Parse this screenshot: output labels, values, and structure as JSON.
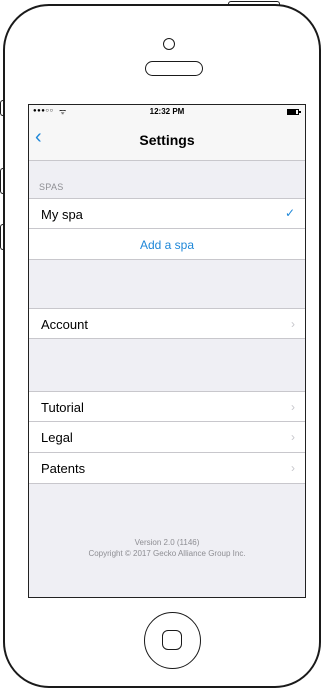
{
  "status_bar": {
    "signal": "●●●○○",
    "wifi": "ᯤ",
    "time": "12:32 PM"
  },
  "nav": {
    "back_icon": "‹",
    "title": "Settings"
  },
  "spas": {
    "header": "SPAS",
    "items": [
      {
        "label": "My spa",
        "selected": true
      }
    ],
    "check_icon": "✓",
    "add_label": "Add a spa"
  },
  "account": {
    "label": "Account"
  },
  "info": {
    "items": [
      {
        "label": "Tutorial"
      },
      {
        "label": "Legal"
      },
      {
        "label": "Patents"
      }
    ]
  },
  "chevron_icon": "›",
  "footer": {
    "version": "Version 2.0 (1146)",
    "copyright": "Copyright © 2017 Gecko Alliance Group Inc."
  },
  "colors": {
    "accent": "#1e87d8",
    "background": "#efeff4",
    "separator": "#c8c7cc"
  }
}
